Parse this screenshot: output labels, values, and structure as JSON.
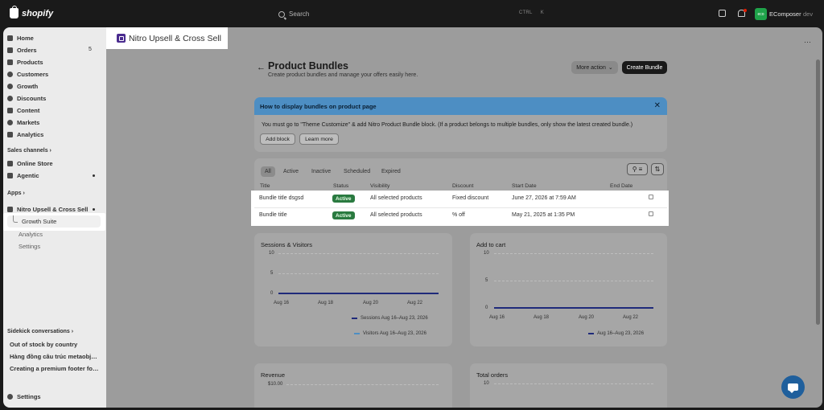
{
  "topbar": {
    "brand": "shopify",
    "search_placeholder": "Search",
    "shortcut_ctrl": "CTRL",
    "shortcut_key": "K",
    "store_initials": "eco",
    "store_name": "EComposer",
    "store_env": "dev"
  },
  "sidebar": {
    "nav": [
      {
        "label": "Home",
        "icon": "home-icon"
      },
      {
        "label": "Orders",
        "icon": "orders-icon",
        "badge": "5"
      },
      {
        "label": "Products",
        "icon": "tag-icon"
      },
      {
        "label": "Customers",
        "icon": "person-icon"
      },
      {
        "label": "Growth",
        "icon": "growth-icon"
      },
      {
        "label": "Discounts",
        "icon": "discount-icon"
      },
      {
        "label": "Content",
        "icon": "content-icon"
      },
      {
        "label": "Markets",
        "icon": "globe-icon"
      },
      {
        "label": "Analytics",
        "icon": "analytics-icon"
      }
    ],
    "sales_channels_label": "Sales channels",
    "channels": [
      {
        "label": "Online Store",
        "icon": "store-icon"
      },
      {
        "label": "Agentic",
        "icon": "agentic-icon"
      }
    ],
    "apps_label": "Apps",
    "app": {
      "label": "Nitro Upsell & Cross Sell"
    },
    "app_sub": [
      "Growth Suite",
      "Analytics",
      "Settings"
    ],
    "sidekick_label": "Sidekick conversations",
    "sidekick": [
      "Out of stock by country",
      "Hàng đồng câu trúc metaobjec...",
      "Creating a premium footer for ..."
    ],
    "settings_label": "Settings"
  },
  "app_header": {
    "title": "Nitro Upsell & Cross Sell",
    "menu_glyph": "⋯"
  },
  "page": {
    "title": "Product Bundles",
    "subtitle": "Create product bundles and manage your offers easily here.",
    "more_action": "More action",
    "create_button": "Create Bundle"
  },
  "banner": {
    "title": "How to display bundles on product page",
    "text": "You must go to \"Theme Customize\" & add Nitro Product Bundle block. (If a product belongs to multiple bundles, only show the latest created bundle.)",
    "add_block": "Add block",
    "learn_more": "Learn more"
  },
  "bundles": {
    "tabs": [
      "All",
      "Active",
      "Inactive",
      "Scheduled",
      "Expired"
    ],
    "active_tab": "All",
    "columns": [
      "Title",
      "Status",
      "Visibility",
      "Discount",
      "Start Date",
      "End Date"
    ],
    "rows": [
      {
        "title": "Bundle title dsgsd",
        "status": "Active",
        "visibility": "All selected products",
        "discount": "Fixed discount",
        "start": "June 27, 2026 at 7:59 AM",
        "end": ""
      },
      {
        "title": "Bundle title",
        "status": "Active",
        "visibility": "All selected products",
        "discount": "% off",
        "start": "May 21, 2025 at 1:35 PM",
        "end": ""
      }
    ]
  },
  "colors": {
    "series_primary": "#1f2a7a",
    "series_secondary": "#4d8ec3",
    "active_badge": "#2a7a40",
    "banner_head": "#4d8ec3"
  },
  "chart_data": [
    {
      "type": "line",
      "title": "Sessions & Visitors",
      "x": [
        "Aug 16",
        "Aug 18",
        "Aug 20",
        "Aug 22"
      ],
      "ylim": [
        0,
        10
      ],
      "y_ticks": [
        "10",
        "5",
        "0"
      ],
      "series": [
        {
          "name": "Sessions Aug 16–Aug 23, 2026",
          "values": [
            0,
            0,
            0,
            0
          ]
        },
        {
          "name": "Visitors Aug 16–Aug 23, 2026",
          "values": [
            0,
            0,
            0,
            0
          ]
        }
      ],
      "legend": "bottom-right"
    },
    {
      "type": "line",
      "title": "Add to cart",
      "x": [
        "Aug 16",
        "Aug 18",
        "Aug 20",
        "Aug 22"
      ],
      "ylim": [
        0,
        10
      ],
      "y_ticks": [
        "10",
        "5",
        "0"
      ],
      "series": [
        {
          "name": "Aug 16–Aug 23, 2026",
          "values": [
            0,
            0,
            0,
            0
          ]
        }
      ],
      "legend": "bottom-right"
    },
    {
      "type": "line",
      "title": "Revenue",
      "y_ticks": [
        "$10.00"
      ],
      "series": []
    },
    {
      "type": "line",
      "title": "Total orders",
      "y_ticks": [
        "10"
      ],
      "series": []
    }
  ]
}
